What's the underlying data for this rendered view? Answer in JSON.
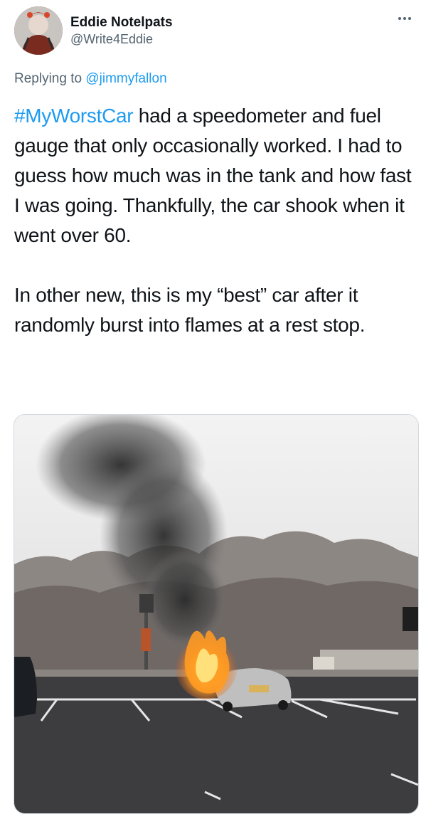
{
  "author": {
    "display_name": "Eddie Notelpats",
    "handle": "@Write4Eddie"
  },
  "reply": {
    "prefix": "Replying to",
    "mention": "@jimmyfallon"
  },
  "tweet": {
    "hashtag": "#MyWorstCar",
    "body": " had a speedometer and fuel gauge that only occasionally worked. I had to guess how much was in the tank and how fast I was going. Thankfully, the car shook when it went over 60.\n\nIn other new, this is my “best” car after it randomly burst into flames at a rest stop."
  },
  "colors": {
    "link": "#1d9bf0",
    "secondary_text": "#536471",
    "primary_text": "#0f1419"
  },
  "icons": {
    "more": "more-horizontal-icon"
  }
}
